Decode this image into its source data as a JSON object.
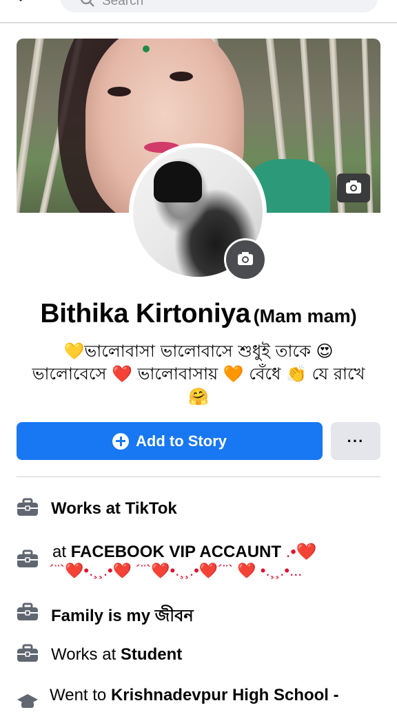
{
  "search": {
    "placeholder": "Search"
  },
  "profile": {
    "name": "Bithika Kirtoniya",
    "alternate_name": "(Mam mam)",
    "bio_line1": "💛ভালোবাসা ভালোবাসে শুধুই তাকে 😍",
    "bio_line2": "ভালোবেসে ❤️ ভালোবাসায় 🧡 বেঁধে 👏 যে রাখে",
    "bio_line3": "🤗"
  },
  "actions": {
    "add_story_label": "Add to Story",
    "more_label": "···"
  },
  "info": {
    "work1": "Works at TikTok",
    "work2_prefix": "at",
    "work2_bold": "FACEBOOK VIP ACCAUNT",
    "work2_hearts_line1": " .•❤️",
    "work2_hearts_line2": "´¨`❤️•.¸¸.•❤️ ´¨`❤️•.¸¸.•❤️´¨` ❤️ •.¸¸.•...",
    "family": "Family is my জীবন",
    "work3_prefix": "Works at",
    "work3_bold": "Student",
    "edu_prefix": "Went to",
    "edu_bold": "Krishnadevpur High School -"
  },
  "colors": {
    "primary": "#1877f2",
    "secondary_button": "#e4e6eb",
    "divider": "#ced0d4",
    "icon": "#606770"
  }
}
